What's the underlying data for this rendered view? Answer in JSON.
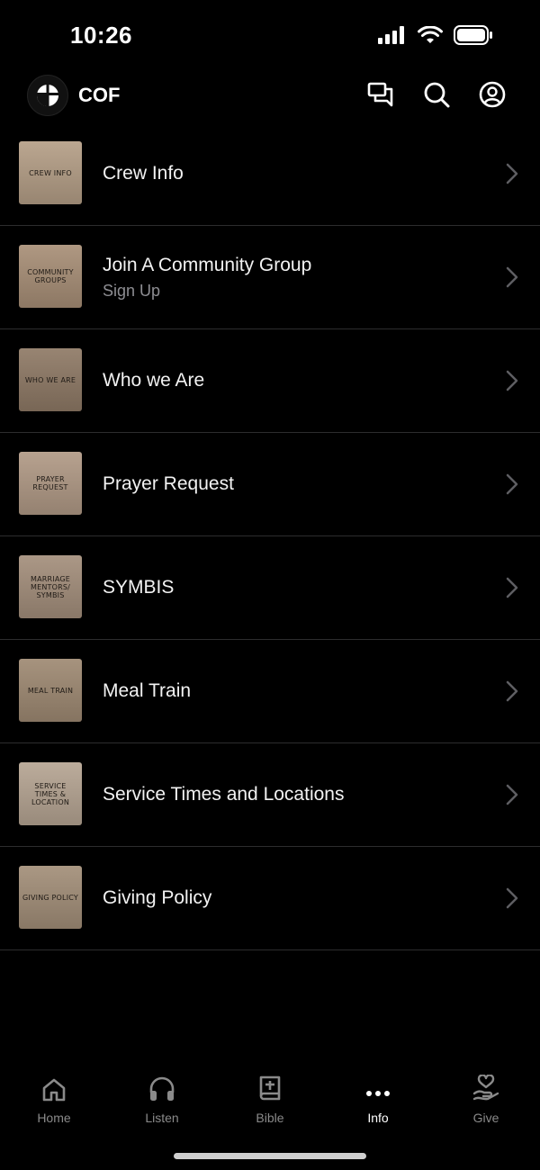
{
  "status": {
    "time": "10:26"
  },
  "header": {
    "brand": "COF"
  },
  "menu_items": [
    {
      "title": "Crew Info",
      "subtitle": "",
      "thumb_text": "CREW INFO",
      "thumb_color": "#b59f87"
    },
    {
      "title": "Join A Community Group",
      "subtitle": "Sign Up",
      "thumb_text": "COMMUNITY GROUPS",
      "thumb_color": "#a88f77"
    },
    {
      "title": "Who we Are",
      "subtitle": "",
      "thumb_text": "WHO WE ARE",
      "thumb_color": "#8f7a66"
    },
    {
      "title": "Prayer Request",
      "subtitle": "",
      "thumb_text": "PRAYER REQUEST",
      "thumb_color": "#b19a86"
    },
    {
      "title": "SYMBIS",
      "subtitle": "",
      "thumb_text": "MARRIAGE MENTORS/ SYMBIS",
      "thumb_color": "#a48f7c"
    },
    {
      "title": "Meal Train",
      "subtitle": "",
      "thumb_text": "MEAL TRAIN",
      "thumb_color": "#9f8a73"
    },
    {
      "title": "Service Times and Locations",
      "subtitle": "",
      "thumb_text": "SERVICE TIMES & LOCATION",
      "thumb_color": "#b6a593"
    },
    {
      "title": "Giving Policy",
      "subtitle": "",
      "thumb_text": "GIVING POLICY",
      "thumb_color": "#a38f79"
    }
  ],
  "tabs": [
    {
      "label": "Home",
      "icon": "home-icon",
      "active": false
    },
    {
      "label": "Listen",
      "icon": "headphones-icon",
      "active": false
    },
    {
      "label": "Bible",
      "icon": "bible-icon",
      "active": false
    },
    {
      "label": "Info",
      "icon": "more-dots-icon",
      "active": true
    },
    {
      "label": "Give",
      "icon": "give-heart-hand-icon",
      "active": false
    }
  ],
  "colors": {
    "background": "#000000",
    "separator": "#2c2c2e",
    "muted_text": "#8e8e93",
    "tab_inactive": "#8a8a8a",
    "tab_active": "#ffffff"
  }
}
